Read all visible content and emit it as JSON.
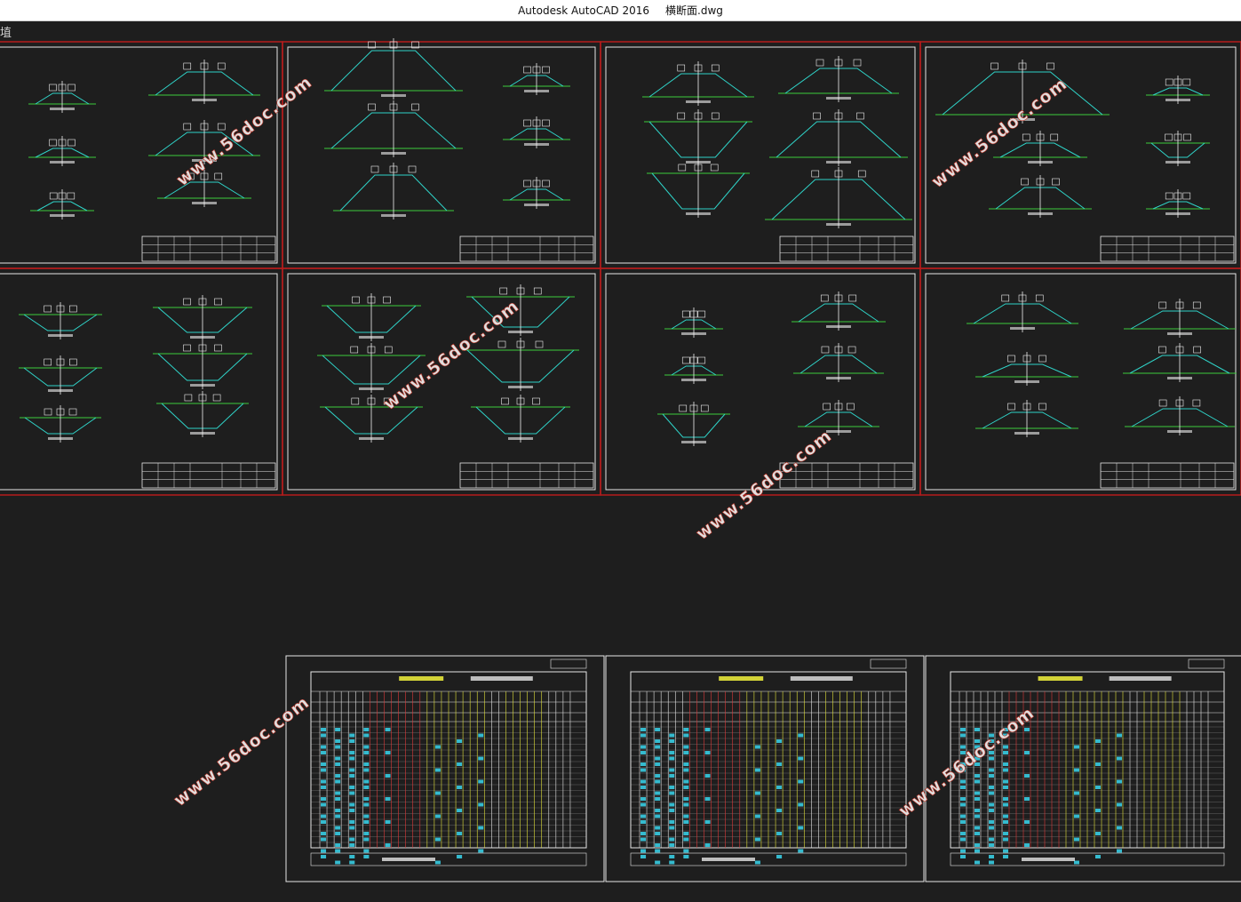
{
  "window": {
    "app_name": "Autodesk AutoCAD 2016",
    "file_name": "横断面.dwg"
  },
  "viewport": {
    "corner_label": "埴"
  },
  "watermark": "www.56doc.com",
  "colors": {
    "background": "#1e1e1e",
    "sheet_border_red": "#b51c1c",
    "sheet_border_white": "#e6e6e6",
    "section_green": "#3ccc3c",
    "section_cyan": "#2fd3c8",
    "centerline_white": "#f0f0f0",
    "table_yellow": "#e5e53a",
    "table_red": "#e03b3b",
    "table_cyan": "#3ad7ee"
  }
}
